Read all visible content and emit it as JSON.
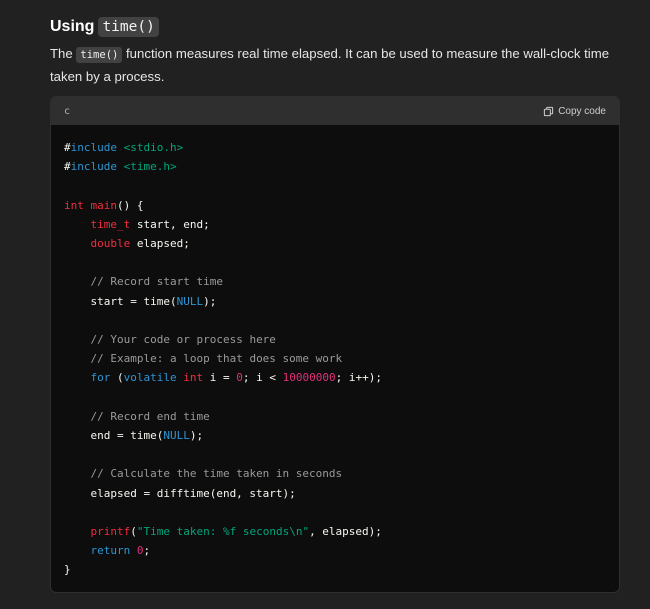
{
  "section": {
    "heading_prefix": "Using",
    "heading_code": "time()",
    "para_part1": "The",
    "para_code": "time()",
    "para_part2": "function measures real time elapsed. It can be used to measure the wall-clock time taken by a process."
  },
  "code_block": {
    "language": "c",
    "copy_label": "Copy code",
    "lines": [
      [
        {
          "t": "#",
          "c": "plain"
        },
        {
          "t": "include",
          "c": "pp"
        },
        {
          "t": " ",
          "c": "plain"
        },
        {
          "t": "<stdio.h>",
          "c": "str"
        }
      ],
      [
        {
          "t": "#",
          "c": "plain"
        },
        {
          "t": "include",
          "c": "pp"
        },
        {
          "t": " ",
          "c": "plain"
        },
        {
          "t": "<time.h>",
          "c": "str"
        }
      ],
      [],
      [
        {
          "t": "int",
          "c": "kw-red"
        },
        {
          "t": " ",
          "c": "plain"
        },
        {
          "t": "main",
          "c": "kw-red"
        },
        {
          "t": "() {",
          "c": "plain"
        }
      ],
      [
        {
          "t": "    ",
          "c": "plain"
        },
        {
          "t": "time_t",
          "c": "kw-red"
        },
        {
          "t": " start, end;",
          "c": "plain"
        }
      ],
      [
        {
          "t": "    ",
          "c": "plain"
        },
        {
          "t": "double",
          "c": "kw-red"
        },
        {
          "t": " elapsed;",
          "c": "plain"
        }
      ],
      [],
      [
        {
          "t": "    ",
          "c": "plain"
        },
        {
          "t": "// Record start time",
          "c": "cmt"
        }
      ],
      [
        {
          "t": "    start = time(",
          "c": "plain"
        },
        {
          "t": "NULL",
          "c": "kw-blue"
        },
        {
          "t": ");",
          "c": "plain"
        }
      ],
      [],
      [
        {
          "t": "    ",
          "c": "plain"
        },
        {
          "t": "// Your code or process here",
          "c": "cmt"
        }
      ],
      [
        {
          "t": "    ",
          "c": "plain"
        },
        {
          "t": "// Example: a loop that does some work",
          "c": "cmt"
        }
      ],
      [
        {
          "t": "    ",
          "c": "plain"
        },
        {
          "t": "for",
          "c": "kw-blue"
        },
        {
          "t": " (",
          "c": "plain"
        },
        {
          "t": "volatile",
          "c": "kw-blue"
        },
        {
          "t": " ",
          "c": "plain"
        },
        {
          "t": "int",
          "c": "kw-red"
        },
        {
          "t": " i = ",
          "c": "plain"
        },
        {
          "t": "0",
          "c": "num"
        },
        {
          "t": "; i < ",
          "c": "plain"
        },
        {
          "t": "10000000",
          "c": "num"
        },
        {
          "t": "; i++);",
          "c": "plain"
        }
      ],
      [],
      [
        {
          "t": "    ",
          "c": "plain"
        },
        {
          "t": "// Record end time",
          "c": "cmt"
        }
      ],
      [
        {
          "t": "    end = time(",
          "c": "plain"
        },
        {
          "t": "NULL",
          "c": "kw-blue"
        },
        {
          "t": ");",
          "c": "plain"
        }
      ],
      [],
      [
        {
          "t": "    ",
          "c": "plain"
        },
        {
          "t": "// Calculate the time taken in seconds",
          "c": "cmt"
        }
      ],
      [
        {
          "t": "    elapsed = difftime(end, start);",
          "c": "plain"
        }
      ],
      [],
      [
        {
          "t": "    ",
          "c": "plain"
        },
        {
          "t": "printf",
          "c": "kw-red"
        },
        {
          "t": "(",
          "c": "plain"
        },
        {
          "t": "\"Time taken: %f seconds\\n\"",
          "c": "str"
        },
        {
          "t": ", elapsed);",
          "c": "plain"
        }
      ],
      [
        {
          "t": "    ",
          "c": "plain"
        },
        {
          "t": "return",
          "c": "kw-blue"
        },
        {
          "t": " ",
          "c": "plain"
        },
        {
          "t": "0",
          "c": "num"
        },
        {
          "t": ";",
          "c": "plain"
        }
      ],
      [
        {
          "t": "}",
          "c": "plain"
        }
      ]
    ]
  },
  "icons": {
    "copy": "copy-icon"
  }
}
